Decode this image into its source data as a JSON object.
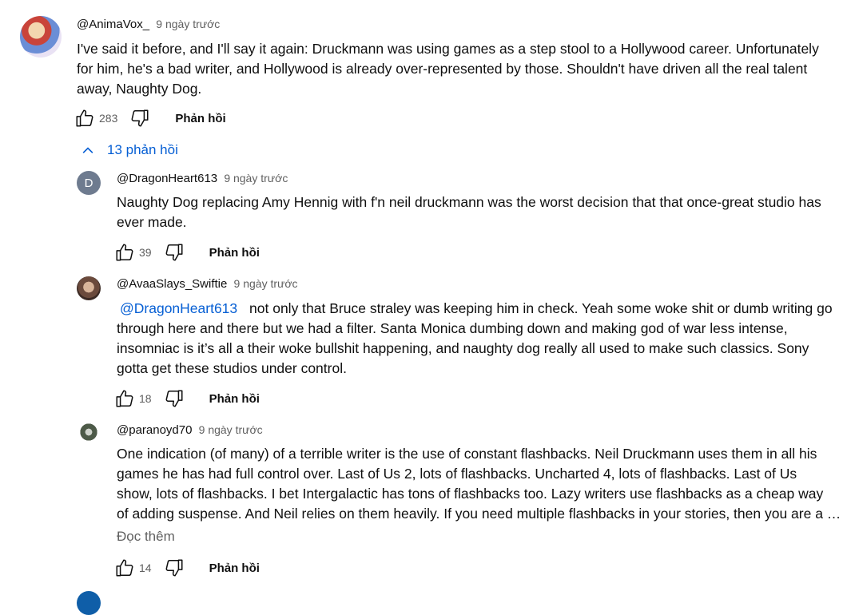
{
  "top_comment": {
    "author": "@AnimaVox_",
    "time": "9 ngày trước",
    "lines": [
      "I've said it before, and I'll say it again: Druckmann was using games as a step stool to a Hollywood career. Unfortunately",
      "for him, he's a bad writer, and Hollywood is already over-represented by those. Shouldn't have driven all the real talent",
      "away, Naughty Dog."
    ],
    "likes": "283",
    "reply_label": "Phản hồi"
  },
  "replies_toggle": {
    "label": "13 phản hồi",
    "icon": "chevron-up-icon"
  },
  "replies": [
    {
      "avatar_letter": "D",
      "author": "@DragonHeart613",
      "time": "9 ngày trước",
      "lines": [
        "Naughty Dog replacing Amy Hennig with f'n neil druckmann was the worst decision that that once-great studio has",
        "ever made."
      ],
      "likes": "39",
      "reply_label": "Phản hồi"
    },
    {
      "author": "@AvaaSlays_Swiftie",
      "time": "9 ngày trước",
      "mention": "@DragonHeart613",
      "lines": [
        "not only that Bruce straley was keeping him in check. Yeah some woke shit or dumb writing go",
        "through here and there but we had a filter. Santa Monica dumbing down and making god of war less intense,",
        "insomniac is it’s all a their woke bullshit happening, and naughty dog really all used to make such classics. Sony",
        "gotta get these studios under control."
      ],
      "likes": "18",
      "reply_label": "Phản hồi"
    },
    {
      "author": "@paranoyd70",
      "time": "9 ngày trước",
      "lines": [
        "One indication (of many) of a terrible writer is the use of constant flashbacks. Neil Druckmann uses them in all his",
        "games he has had full control over. Last of Us 2, lots of flashbacks. Uncharted 4, lots of flashbacks. Last of Us",
        "show, lots of flashbacks. I bet Intergalactic has tons of flashbacks too. Lazy writers use flashbacks as a cheap way",
        "of adding suspense. And Neil relies on them heavily. If you need multiple flashbacks in your stories, then you are a …"
      ],
      "read_more": "Đọc thêm",
      "likes": "14",
      "reply_label": "Phản hồi"
    }
  ],
  "colors": {
    "link": "#065fd4",
    "secondary_text": "#606060",
    "primary_text": "#0f0f0f"
  }
}
